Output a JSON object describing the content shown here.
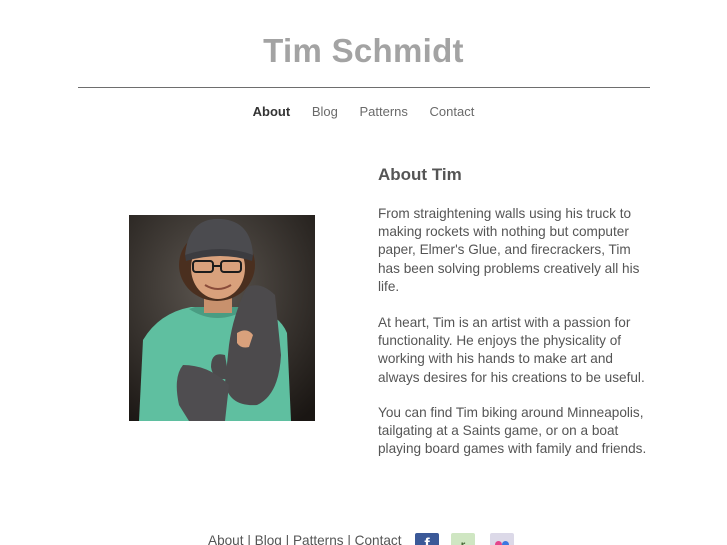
{
  "site": {
    "title": "Tim Schmidt"
  },
  "nav": {
    "items": [
      {
        "label": "About",
        "active": true
      },
      {
        "label": "Blog",
        "active": false
      },
      {
        "label": "Patterns",
        "active": false
      },
      {
        "label": "Contact",
        "active": false
      }
    ]
  },
  "content": {
    "heading": "About Tim",
    "paragraphs": [
      "From straightening walls using his truck to making rockets with nothing but computer paper, Elmer's Glue, and firecrackers, Tim has been solving problems creatively all his life.",
      "At heart, Tim is an artist with a passion for functionality.  He enjoys the physicality of working with his hands to make art and always desires for his creations to be useful.",
      "You can find Tim biking around Minneapolis, tailgating at a Saints game, or on a boat playing board games with family and friends."
    ]
  },
  "footer": {
    "links": [
      "About",
      "Blog",
      "Patterns",
      "Contact"
    ],
    "separator": "|",
    "social": [
      {
        "icon": "facebook-icon",
        "glyph": "f",
        "color": "#3b5998"
      },
      {
        "icon": "ravelry-icon",
        "glyph": "r",
        "color": "#cfe6c2"
      },
      {
        "icon": "flickr-icon",
        "glyph": "",
        "color": "#dcd9e8"
      }
    ]
  }
}
